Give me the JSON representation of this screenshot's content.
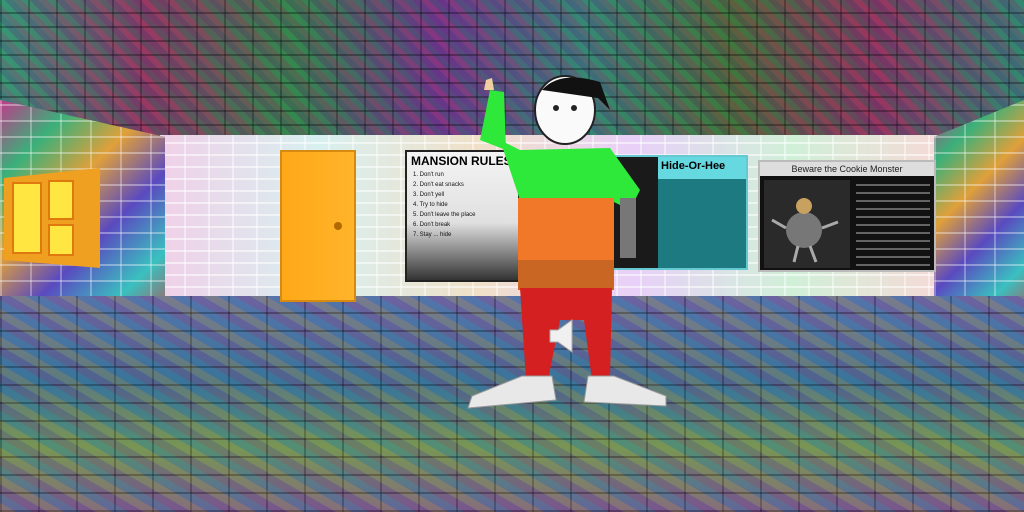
{
  "scene": {
    "colors": {
      "shirt_green": "#2ee83a",
      "shirt_orange": "#f07828",
      "pants_red": "#d42020",
      "door_orange": "#ffa818",
      "window_yellow": "#ffe640",
      "poster_cyan": "#66d8e0"
    },
    "posters": {
      "rules_title": "MANSION RULES",
      "rules": [
        "1. Don't run",
        "2. Don't eat snacks",
        "3. Don't yell",
        "4. Try to hide",
        "5. Don't leave the place",
        "6. Don't break",
        "7. Stay ... hide"
      ],
      "hide_title": "Hide-Or-Hee",
      "cookie_title": "Beware the Cookie Monster"
    },
    "icons": {
      "speaker": "speaker-icon",
      "door": "door-icon",
      "window": "window-icon"
    }
  }
}
